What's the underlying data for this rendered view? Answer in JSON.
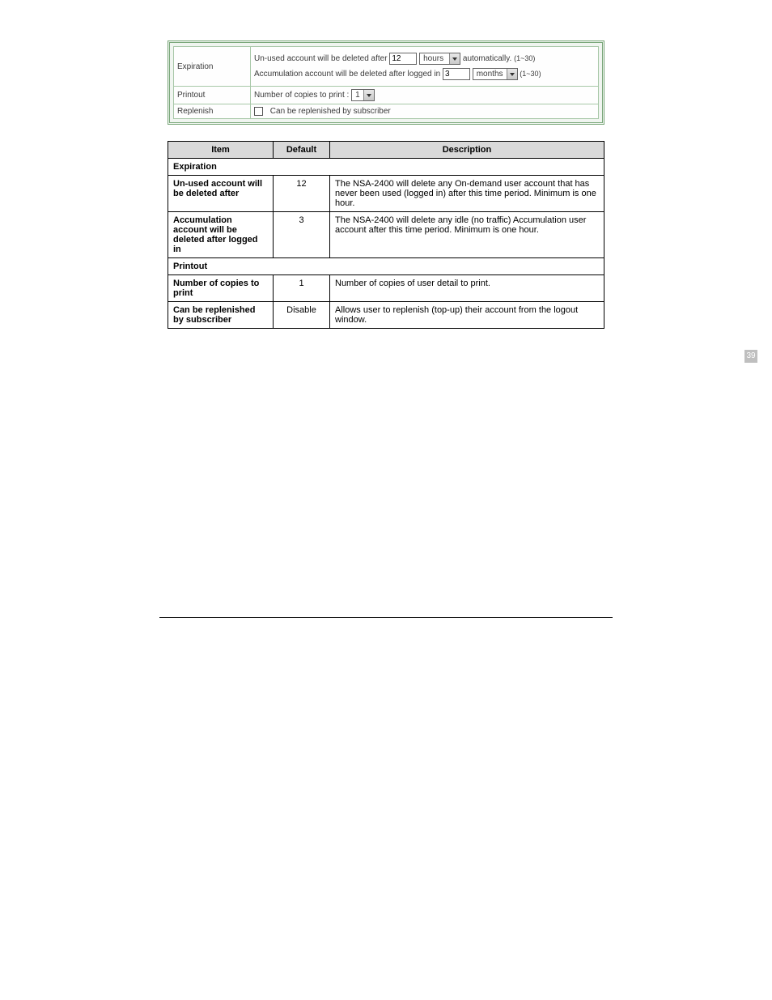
{
  "screenshot": {
    "rows": {
      "expiration_label": "Expiration",
      "printout_label": "Printout",
      "replenish_label": "Replenish"
    },
    "expiration": {
      "line1_pre": "Un-used account will be deleted after",
      "line1_input": "12",
      "line1_unit": "hours",
      "line1_post": "automatically.",
      "line1_hint": "(1~30)",
      "line2_pre": "Accumulation account will be deleted after logged in",
      "line2_input": "3",
      "line2_unit": "months",
      "line2_hint": "(1~30)"
    },
    "printout": {
      "label": "Number of copies to print :",
      "value": "1"
    },
    "replenish": {
      "text": "Can be replenished by subscriber"
    }
  },
  "table": {
    "headers": {
      "item": "Item",
      "default": "Default",
      "description": "Description"
    },
    "section1": "Expiration",
    "rows": [
      {
        "item": "Un-used account will be deleted after",
        "def": "12",
        "desc": "The NSA-2400 will delete any On-demand user account that has never been used (logged in) after this time period. Minimum is one hour."
      },
      {
        "item": "Accumulation account will be deleted after logged in",
        "def": "3",
        "desc": "The NSA-2400 will delete any idle (no traffic) Accumulation user account after this time period. Minimum is one hour."
      }
    ],
    "section2": "Printout",
    "row3": {
      "item": "Number of copies to print",
      "def": "1",
      "desc": "Number of copies of user detail to print."
    },
    "row4": {
      "item": "Can be replenished by subscriber",
      "def": "Disable",
      "desc": "Allows user to replenish (top-up) their account from the logout window."
    }
  },
  "page_number": "39"
}
